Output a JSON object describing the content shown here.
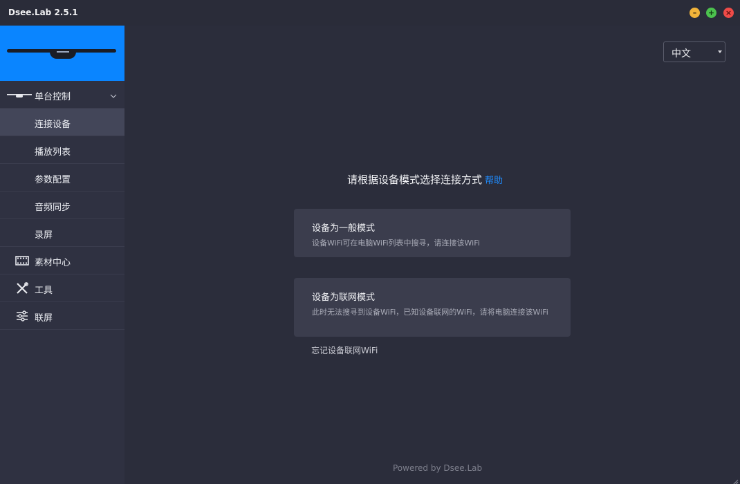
{
  "window": {
    "title": "Dsee.Lab 2.5.1",
    "controls": {
      "minimize": "–",
      "maximize": "+",
      "close": "×"
    }
  },
  "sidebar": {
    "group": {
      "label": "单台控制",
      "icon": "fan-device-icon",
      "expanded": true
    },
    "subitems": [
      {
        "label": "连接设备",
        "active": true
      },
      {
        "label": "播放列表",
        "active": false
      },
      {
        "label": "参数配置",
        "active": false
      },
      {
        "label": "音频同步",
        "active": false
      },
      {
        "label": "录屏",
        "active": false
      }
    ],
    "items": [
      {
        "label": "素材中心",
        "icon": "film-icon"
      },
      {
        "label": "工具",
        "icon": "tools-icon"
      },
      {
        "label": "联屏",
        "icon": "sliders-icon"
      }
    ]
  },
  "language": {
    "selected": "中文"
  },
  "main": {
    "prompt": "请根据设备模式选择连接方式",
    "help_link": "帮助",
    "cards": [
      {
        "title": "设备为一般模式",
        "description": "设备WiFi可在电脑WiFi列表中搜寻，请连接该WiFi"
      },
      {
        "title": "设备为联网模式",
        "description": "此时无法搜寻到设备WiFi，已知设备联网的WiFi，请将电脑连接该WiFi"
      }
    ],
    "forget_link": "忘记设备联网WiFi",
    "footer": "Powered by Dsee.Lab"
  },
  "colors": {
    "accent": "#0a85ff",
    "link": "#1f8cff",
    "background": "#2b2d3b",
    "sidebar": "#2f3141",
    "active_item": "#434659",
    "card": "#3b3d4d"
  }
}
